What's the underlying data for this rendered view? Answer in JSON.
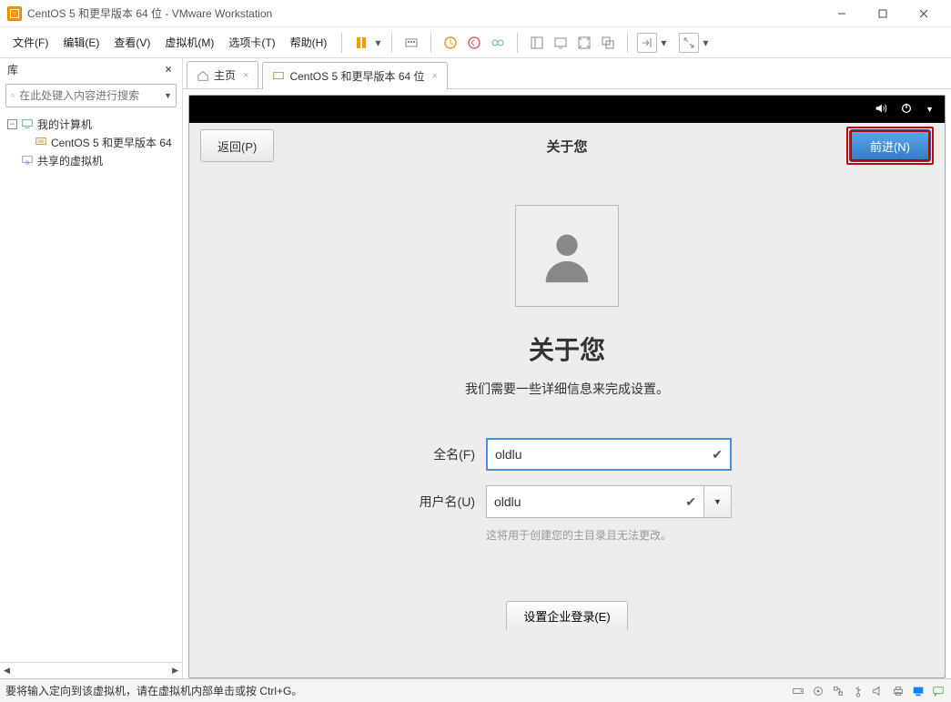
{
  "title": "CentOS 5 和更早版本 64 位 - VMware Workstation",
  "menu": {
    "file": "文件(F)",
    "edit": "编辑(E)",
    "view": "查看(V)",
    "vm": "虚拟机(M)",
    "tabs": "选项卡(T)",
    "help": "帮助(H)"
  },
  "sidebar": {
    "title": "库",
    "search_placeholder": "在此处键入内容进行搜索",
    "items": {
      "my_computer": "我的计算机",
      "centos": "CentOS 5 和更早版本 64",
      "shared": "共享的虚拟机"
    }
  },
  "tabs": {
    "home": "主页",
    "centos": "CentOS 5 和更早版本 64 位"
  },
  "vm": {
    "back": "返回(P)",
    "forward": "前进(N)",
    "header_title": "关于您",
    "about_title": "关于您",
    "about_sub": "我们需要一些详细信息来完成设置。",
    "fullname_label": "全名(F)",
    "fullname_value": "oldlu",
    "username_label": "用户名(U)",
    "username_value": "oldlu",
    "hint": "这将用于创建您的主目录且无法更改。",
    "enterprise": "设置企业登录(E)"
  },
  "statusbar": {
    "text": "要将输入定向到该虚拟机，请在虚拟机内部单击或按 Ctrl+G。"
  }
}
